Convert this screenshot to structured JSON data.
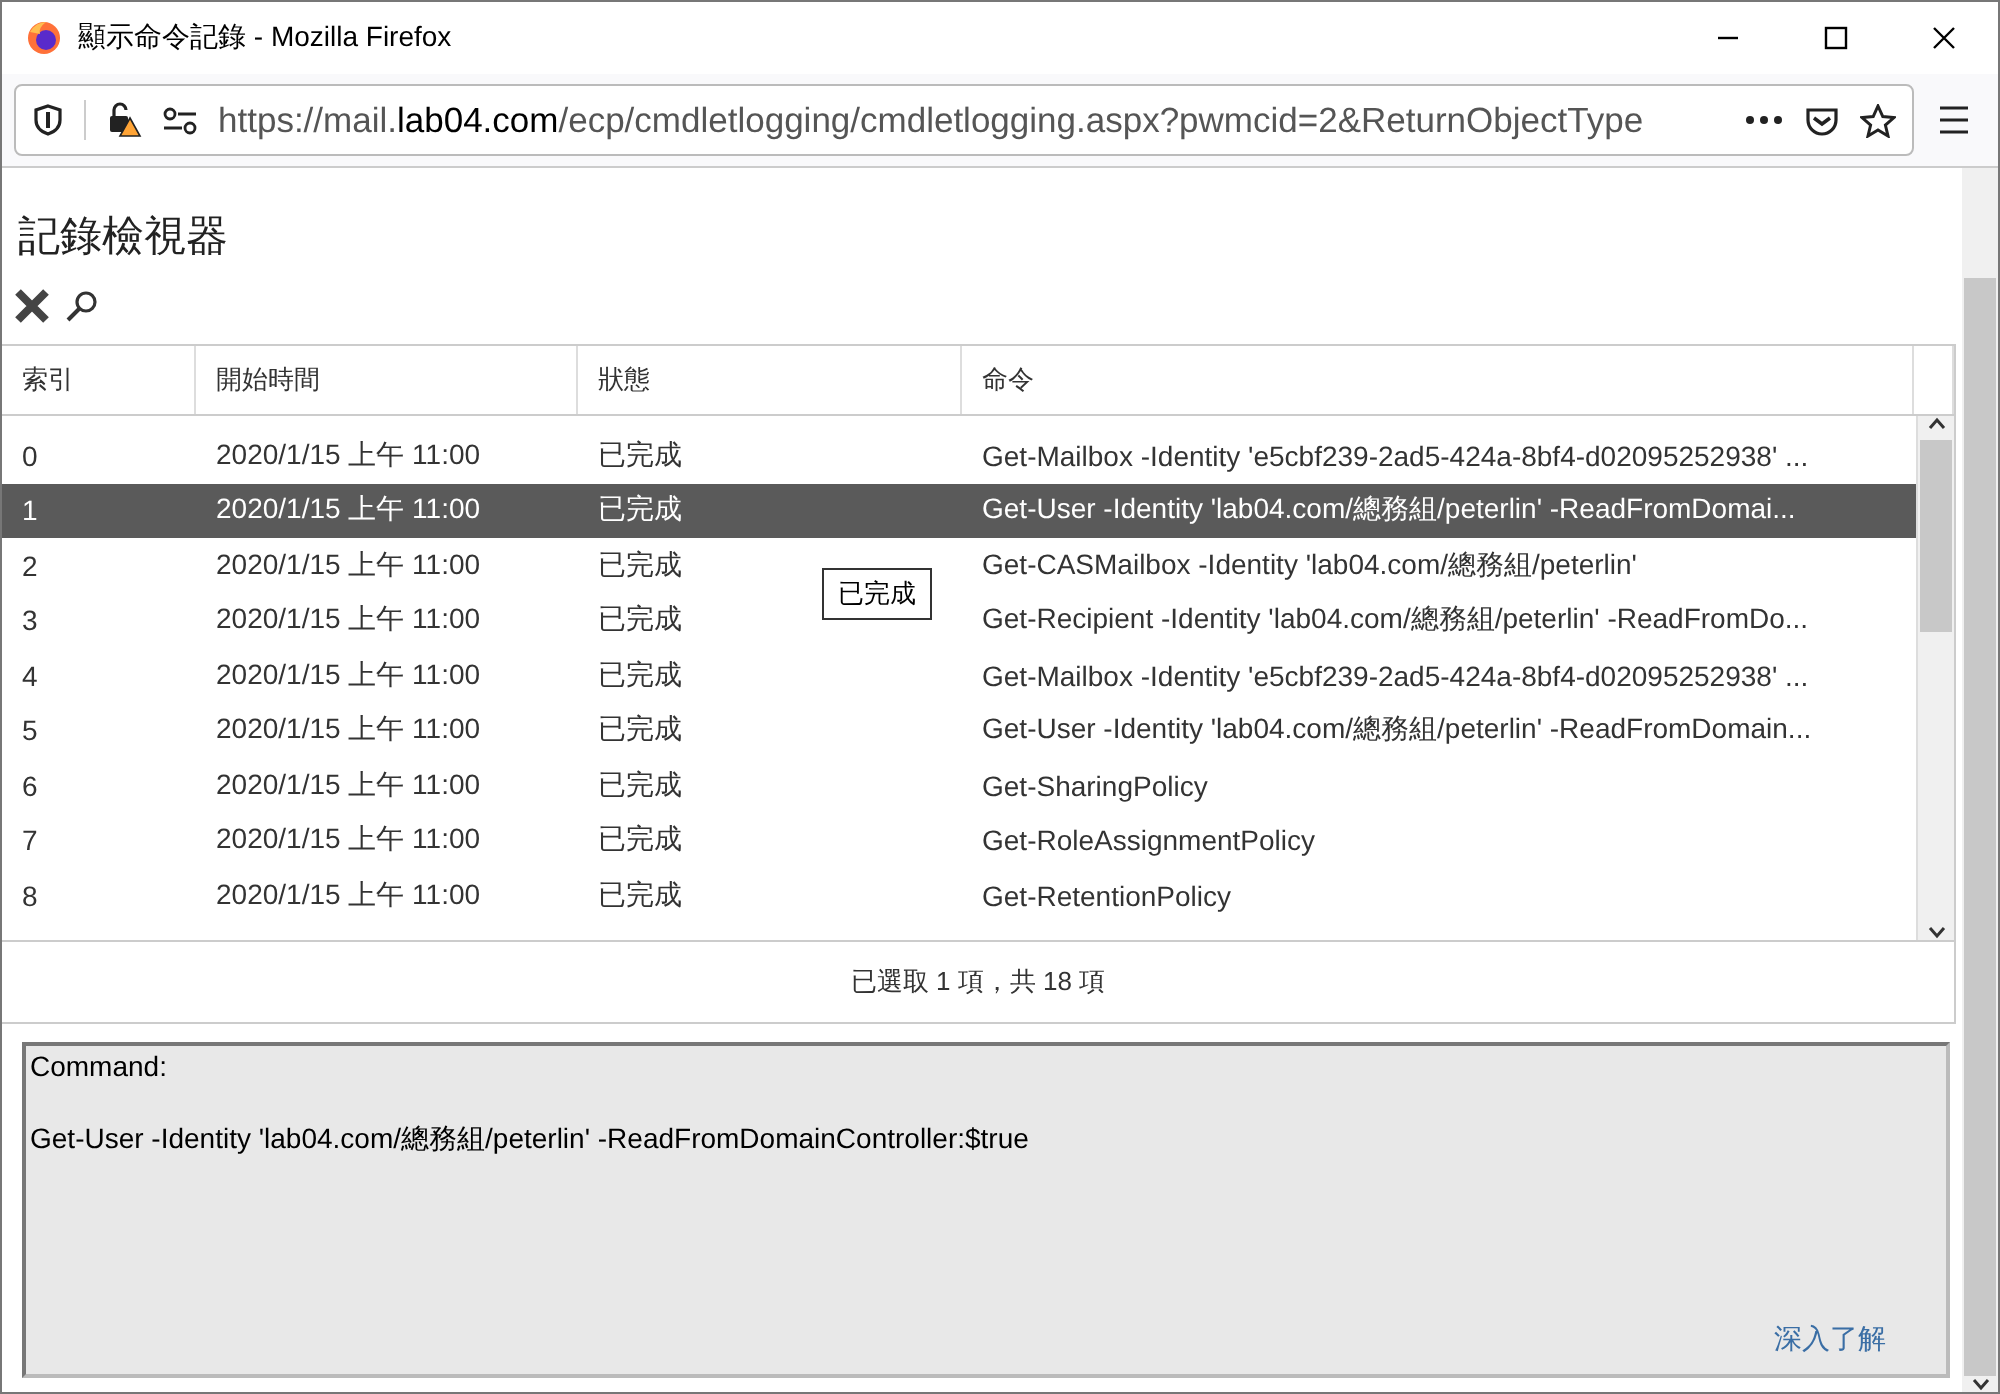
{
  "window": {
    "title": "顯示命令記錄 - Mozilla Firefox"
  },
  "address_bar": {
    "url_prefix": "https://mail.",
    "url_domain": "lab04.com",
    "url_suffix": "/ecp/cmdletlogging/cmdletlogging.aspx?pwmcid=2&ReturnObjectType"
  },
  "page": {
    "title": "記錄檢視器"
  },
  "table": {
    "columns": [
      "索引",
      "開始時間",
      "狀態",
      "命令"
    ],
    "rows": [
      {
        "cells": [
          "0",
          "2020/1/15 上午 11:00",
          "已完成",
          "Get-Mailbox -Identity 'e5cbf239-2ad5-424a-8bf4-d02095252938' ..."
        ],
        "selected": false
      },
      {
        "cells": [
          "1",
          "2020/1/15 上午 11:00",
          "已完成",
          "Get-User -Identity 'lab04.com/總務組/peterlin' -ReadFromDomai..."
        ],
        "selected": true
      },
      {
        "cells": [
          "2",
          "2020/1/15 上午 11:00",
          "已完成",
          "Get-CASMailbox -Identity 'lab04.com/總務組/peterlin'"
        ],
        "selected": false
      },
      {
        "cells": [
          "3",
          "2020/1/15 上午 11:00",
          "已完成",
          "Get-Recipient -Identity 'lab04.com/總務組/peterlin' -ReadFromDo..."
        ],
        "selected": false
      },
      {
        "cells": [
          "4",
          "2020/1/15 上午 11:00",
          "已完成",
          "Get-Mailbox -Identity 'e5cbf239-2ad5-424a-8bf4-d02095252938' ..."
        ],
        "selected": false
      },
      {
        "cells": [
          "5",
          "2020/1/15 上午 11:00",
          "已完成",
          "Get-User -Identity 'lab04.com/總務組/peterlin' -ReadFromDomain..."
        ],
        "selected": false
      },
      {
        "cells": [
          "6",
          "2020/1/15 上午 11:00",
          "已完成",
          "Get-SharingPolicy"
        ],
        "selected": false
      },
      {
        "cells": [
          "7",
          "2020/1/15 上午 11:00",
          "已完成",
          "Get-RoleAssignmentPolicy"
        ],
        "selected": false
      },
      {
        "cells": [
          "8",
          "2020/1/15 上午 11:00",
          "已完成",
          "Get-RetentionPolicy"
        ],
        "selected": false
      }
    ],
    "tooltip": "已完成"
  },
  "status_bar": "已選取 1 項，共 18 項",
  "details": {
    "label": "Command:",
    "command": "Get-User -Identity 'lab04.com/總務組/peterlin' -ReadFromDomainController:$true",
    "link": "深入了解"
  }
}
